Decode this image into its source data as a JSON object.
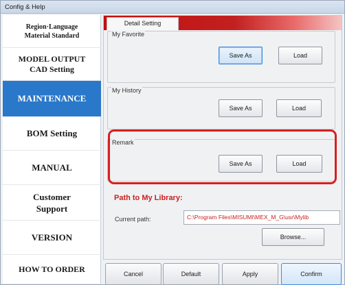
{
  "window": {
    "title": "Config & Help"
  },
  "sidebar": {
    "items": [
      {
        "lines": [
          "Region·Language",
          "Material Standard"
        ],
        "active": false
      },
      {
        "lines": [
          "MODEL OUTPUT",
          "CAD Setting"
        ],
        "active": false
      },
      {
        "lines": [
          "MAINTENANCE"
        ],
        "active": true
      },
      {
        "lines": [
          "BOM Setting"
        ],
        "active": false
      },
      {
        "lines": [
          "MANUAL"
        ],
        "active": false
      },
      {
        "lines": [
          "Customer",
          "Support"
        ],
        "active": false
      },
      {
        "lines": [
          "VERSION"
        ],
        "active": false
      },
      {
        "lines": [
          "HOW TO ORDER"
        ],
        "active": false
      }
    ],
    "active_color": "#2a78c9"
  },
  "panel": {
    "tab_label": "Detail Setting",
    "accent_color": "#c40d0d",
    "groups": {
      "favorite": {
        "label": "My Favorite",
        "save_label": "Save As",
        "load_label": "Load"
      },
      "history": {
        "label": "My History",
        "save_label": "Save As",
        "load_label": "Load"
      },
      "remark": {
        "label": "Remark",
        "save_label": "Save As",
        "load_label": "Load"
      }
    },
    "library": {
      "heading": "Path to My Library:",
      "current_path_label": "Current path:",
      "current_path_value": "C:\\Program Files\\MISUMI\\MEX_M_G\\usr\\Mylib",
      "browse_label": "Browse..."
    }
  },
  "footer": {
    "cancel_label": "Cancel",
    "default_label": "Default",
    "apply_label": "Apply",
    "confirm_label": "Confirm"
  },
  "highlight_color": "#d61f1f"
}
